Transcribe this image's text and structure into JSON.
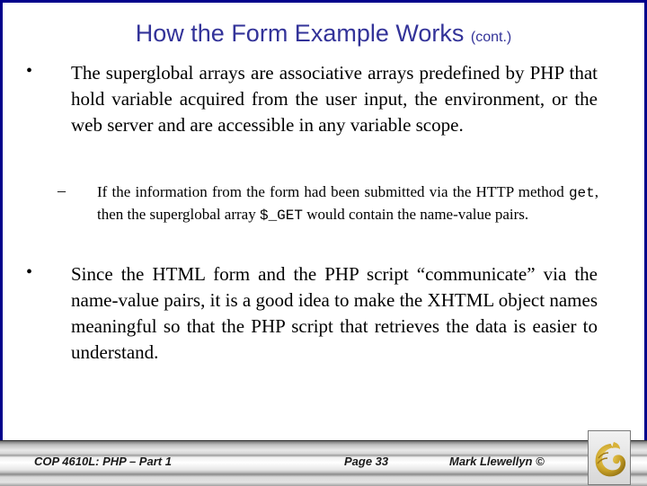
{
  "slide": {
    "title": "How the Form Example Works",
    "title_suffix": "(cont.)",
    "bullets": [
      {
        "marker": "•",
        "text": "The superglobal arrays are associative arrays predefined by PHP that hold variable acquired from the user input, the environment, or the web server and are accessible in any variable scope.",
        "sub_bullets": [
          {
            "marker": "–",
            "text_parts": [
              "If the information from the form had been submitted via the HTTP method ",
              "get",
              ", then the superglobal array ",
              "$_GET",
              " would contain the name-value pairs."
            ]
          }
        ]
      },
      {
        "marker": "•",
        "text": "Since the HTML form and the PHP script “communicate” via the name-value pairs, it is a good idea to make the XHTML object names meaningful so that the PHP script that retrieves the data is easier to understand."
      }
    ]
  },
  "footer": {
    "course": "COP 4610L:  PHP – Part 1",
    "page": "Page 33",
    "author": "Mark Llewellyn ©",
    "logo": "ucf-pegasus-logo-icon"
  },
  "colors": {
    "frame_border": "#00008b",
    "title": "#333399",
    "logo_gold": "#c9a227"
  }
}
